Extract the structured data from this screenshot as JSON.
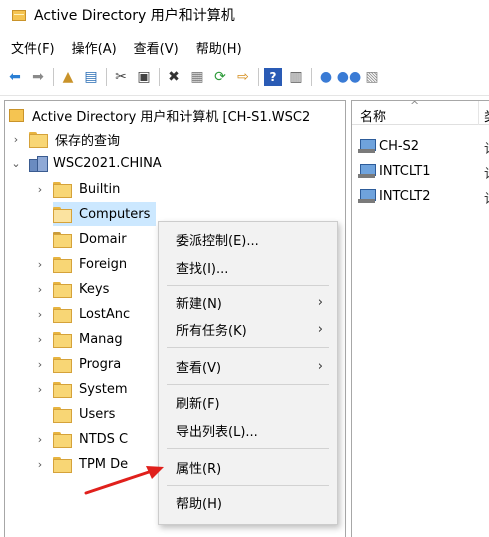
{
  "window": {
    "title": "Active Directory 用户和计算机"
  },
  "menubar": {
    "items": [
      "文件(F)",
      "操作(A)",
      "查看(V)",
      "帮助(H)"
    ]
  },
  "toolbar": {
    "buttons": [
      {
        "name": "back-arrow-icon",
        "glyph": "⬅",
        "color": "#2a7fd4"
      },
      {
        "name": "forward-arrow-icon",
        "glyph": "➡",
        "color": "#8a8a8a"
      },
      {
        "name": "up-folder-icon",
        "glyph": "📁",
        "color": "#c9932a"
      },
      {
        "name": "show-console-tree-icon",
        "glyph": "▤",
        "color": "#2a6db5"
      },
      {
        "name": "cut-icon",
        "glyph": "✂",
        "color": "#444444"
      },
      {
        "name": "copy-icon",
        "glyph": "📋",
        "color": "#444444"
      },
      {
        "name": "delete-icon",
        "glyph": "✖",
        "color": "#333333"
      },
      {
        "name": "properties-icon",
        "glyph": "▦",
        "color": "#777777"
      },
      {
        "name": "refresh-icon",
        "glyph": "⟳",
        "color": "#2e9b3a"
      },
      {
        "name": "export-icon",
        "glyph": "⇨",
        "color": "#d48c1a"
      },
      {
        "name": "help-icon",
        "glyph": "?",
        "color": "#ffffff"
      },
      {
        "name": "mmc-view-icon",
        "glyph": "▥",
        "color": "#555555"
      },
      {
        "name": "new-user-icon",
        "glyph": "👤",
        "color": "#3a7bd5"
      },
      {
        "name": "new-group-icon",
        "glyph": "👥",
        "color": "#3a7bd5"
      },
      {
        "name": "new-ou-icon",
        "glyph": "🗂",
        "color": "#888888"
      }
    ]
  },
  "tree": {
    "root_label": "Active Directory 用户和计算机 [CH-S1.WSC2",
    "saved_queries": "保存的查询",
    "domain": "WSC2021.CHINA",
    "nodes": [
      "Builtin",
      "Computers",
      "Domair",
      "Foreign",
      "Keys",
      "LostAnc",
      "Manag",
      "Progra",
      "System",
      "Users",
      "NTDS C",
      "TPM De"
    ]
  },
  "list": {
    "header": "名称",
    "header_next": "类",
    "items": [
      "CH-S2",
      "INTCLT1",
      "INTCLT2"
    ],
    "items_type_cut": "计"
  },
  "context_menu": {
    "delegate": "委派控制(E)...",
    "find": "查找(I)...",
    "new": "新建(N)",
    "all_tasks": "所有任务(K)",
    "view": "查看(V)",
    "refresh": "刷新(F)",
    "export": "导出列表(L)...",
    "properties": "属性(R)",
    "help": "帮助(H)"
  },
  "colors": {
    "selection": "#cce8ff",
    "annotation_arrow": "#e0201c"
  }
}
